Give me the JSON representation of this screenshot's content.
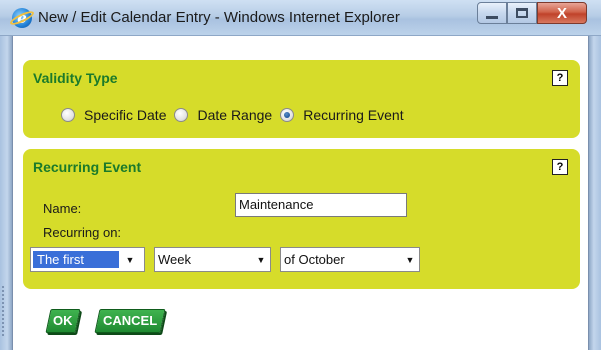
{
  "window": {
    "title": "New / Edit Calendar Entry - Windows Internet Explorer",
    "close_label": "X"
  },
  "validity_panel": {
    "title": "Validity Type",
    "help_label": "?",
    "options": [
      {
        "label": "Specific Date",
        "checked": false
      },
      {
        "label": "Date Range",
        "checked": false
      },
      {
        "label": "Recurring Event",
        "checked": true
      }
    ]
  },
  "recurring_panel": {
    "title": "Recurring Event",
    "help_label": "?",
    "name_label": "Name:",
    "name_value": "Maintenance",
    "recurring_on_label": "Recurring on:",
    "ordinal_select": "The first",
    "unit_select": "Week",
    "month_select": "of October"
  },
  "buttons": {
    "ok": "OK",
    "cancel": "CANCEL"
  },
  "colors": {
    "panel_bg": "#d6dc2a",
    "panel_title": "#1b7a2a",
    "button_green": "#1f8a31",
    "selection_blue": "#3a6fd8"
  }
}
